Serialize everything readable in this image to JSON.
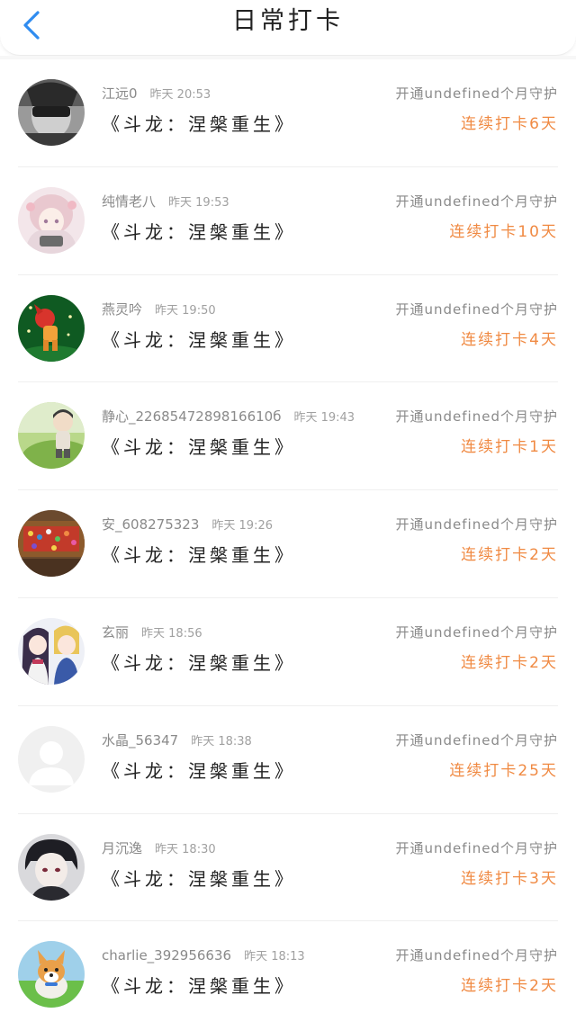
{
  "header": {
    "title": "日常打卡",
    "back_icon": "chevron-left-icon",
    "accent": "#2f8cf0"
  },
  "colors": {
    "streak": "#f08a43",
    "meta": "#8a8a8a"
  },
  "checkins": [
    {
      "name": "江远0",
      "time": "昨天 20:53",
      "book": "《斗龙：涅槃重生》",
      "guard": "开通undefined个月守护",
      "streak": "连续打卡6天",
      "avatar": "gray-portrait"
    },
    {
      "name": "纯情老八",
      "time": "昨天 19:53",
      "book": "《斗龙：涅槃重生》",
      "guard": "开通undefined个月守护",
      "streak": "连续打卡10天",
      "avatar": "pink-anime-girl"
    },
    {
      "name": "燕灵吟",
      "time": "昨天 19:50",
      "book": "《斗龙：涅槃重生》",
      "guard": "开通undefined个月守护",
      "streak": "连续打卡4天",
      "avatar": "green-character"
    },
    {
      "name": "静心_2268547289816610б",
      "time": "昨天 19:43",
      "book": "《斗龙：涅槃重生》",
      "guard": "开通undefined个月守护",
      "streak": "连续打卡1天",
      "avatar": "child-on-grass"
    },
    {
      "name": "安_608275323",
      "time": "昨天 19:26",
      "book": "《斗龙：涅槃重生》",
      "guard": "开通undefined个月守护",
      "streak": "连续打卡2天",
      "avatar": "colorful-shelf"
    },
    {
      "name": "玄丽",
      "time": "昨天 18:56",
      "book": "《斗龙：涅槃重生》",
      "guard": "开通undefined个月守护",
      "streak": "连续打卡2天",
      "avatar": "anime-pair"
    },
    {
      "name": "水晶_56347",
      "time": "昨天 18:38",
      "book": "《斗龙：涅槃重生》",
      "guard": "开通undefined个月守护",
      "streak": "连续打卡25天",
      "avatar": "default-person"
    },
    {
      "name": "月沉逸",
      "time": "昨天 18:30",
      "book": "《斗龙：涅槃重生》",
      "guard": "开通undefined个月守护",
      "streak": "连续打卡3天",
      "avatar": "dark-hair-boy"
    },
    {
      "name": "charlie_392956636",
      "time": "昨天 18:13",
      "book": "《斗龙：涅槃重生》",
      "guard": "开通undefined个月守护",
      "streak": "连续打卡2天",
      "avatar": "corgi-dog"
    }
  ]
}
